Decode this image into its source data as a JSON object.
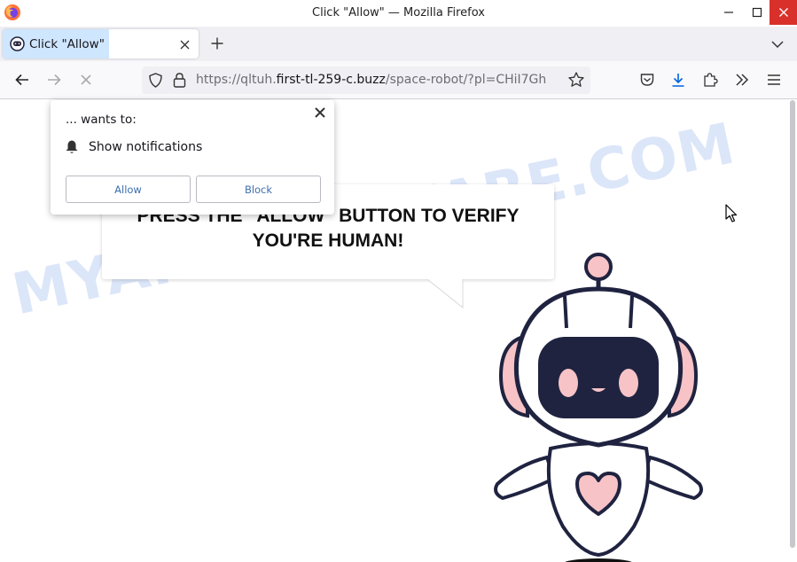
{
  "window": {
    "title": "Click \"Allow\" — Mozilla Firefox"
  },
  "tabs": [
    {
      "label": "Click \"Allow\""
    }
  ],
  "urlbar": {
    "prefix": "https://qltuh.",
    "domain": "first-tl-259-c.buzz",
    "path": "/space-robot/?pl=CHiI7Gh"
  },
  "popup": {
    "wants_to": "... wants to:",
    "permission": "Show notifications",
    "allow_label": "Allow",
    "block_label": "Block"
  },
  "page": {
    "message": "PRESS THE \"ALLOW\" BUTTON TO VERIFY YOU'RE HUMAN!",
    "watermark": "MYANTISPYWARE.COM"
  },
  "icons": {
    "back": "arrow-left-icon",
    "forward": "arrow-right-icon",
    "stop": "stop-x-icon",
    "shield": "shield-icon",
    "lock": "lock-icon",
    "bookmark": "star-icon",
    "pocket": "pocket-icon",
    "downloads": "download-icon",
    "extensions": "puzzle-icon",
    "overflow": "chevrons-right-icon",
    "menu": "hamburger-icon",
    "bell": "bell-icon"
  },
  "colors": {
    "tab_highlight": "#cfe6ff",
    "close_button": "#d9302b",
    "link_blue": "#3e6fb0",
    "robot_pink": "#f7c3c6",
    "robot_navy": "#1f2340"
  }
}
